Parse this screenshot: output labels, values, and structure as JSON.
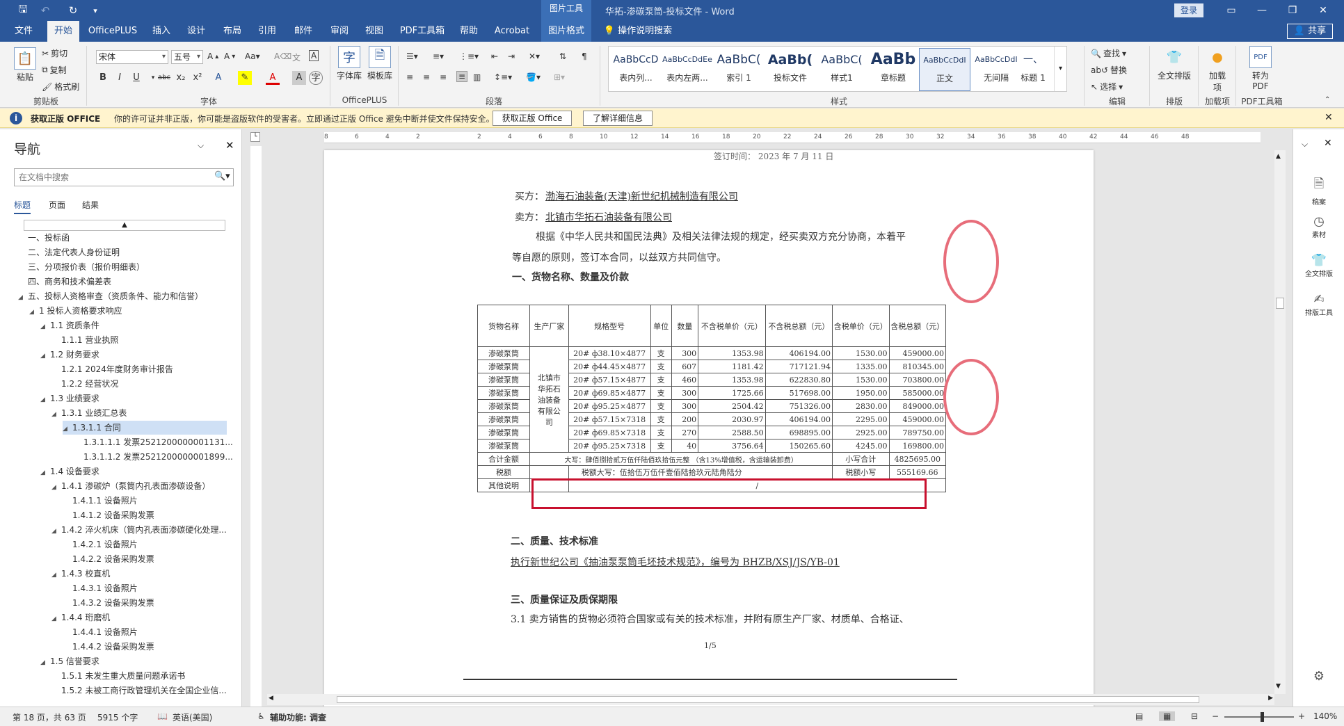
{
  "titlebar": {
    "contextual_tab": "图片工具",
    "title": "华拓-渗碳泵筒-投标文件 - Word",
    "login": "登录"
  },
  "tabs": [
    "文件",
    "开始",
    "OfficePLUS",
    "插入",
    "设计",
    "布局",
    "引用",
    "邮件",
    "审阅",
    "视图",
    "PDF工具箱",
    "帮助",
    "Acrobat",
    "图片格式",
    "操作说明搜索"
  ],
  "share": "共享",
  "ribbon": {
    "clipboard": {
      "paste": "粘贴",
      "cut": "剪切",
      "copy": "复制",
      "format_painter": "格式刷",
      "label": "剪贴板"
    },
    "font": {
      "name": "宋体",
      "size": "五号",
      "label": "字体"
    },
    "officeplus": {
      "font_lib": "字体库",
      "template_lib": "模板库",
      "label": "OfficePLUS"
    },
    "paragraph": {
      "label": "段落"
    },
    "styles": {
      "label": "样式",
      "items": [
        {
          "preview": "AaBbCcD",
          "name": "表内列..."
        },
        {
          "preview": "AaBbCcDdEe",
          "name": "表内左两..."
        },
        {
          "preview": "AaBbC(",
          "name": "索引 1"
        },
        {
          "preview": "AaBb(",
          "name": "投标文件"
        },
        {
          "preview": "AaBbC(",
          "name": "样式1"
        },
        {
          "preview": "AaBb",
          "name": "章标题"
        },
        {
          "preview": "AaBbCcDdI",
          "name": "正文"
        },
        {
          "preview": "AaBbCcDdI",
          "name": "无间隔"
        },
        {
          "preview": "一、",
          "name": "标题 1"
        }
      ]
    },
    "editing": {
      "find": "查找",
      "replace": "替换",
      "select": "选择",
      "label": "编辑"
    },
    "layout": {
      "full_text": "全文排版",
      "label": "排版"
    },
    "addins": {
      "add": "加载项",
      "label": "加载项"
    },
    "pdf": {
      "convert": "转为 PDF",
      "label": "PDF工具箱"
    }
  },
  "infobar": {
    "title": "获取正版 OFFICE",
    "message": "你的许可证并非正版，你可能是盗版软件的受害者。立即通过正版 Office 避免中断并使文件保持安全。",
    "btn_get": "获取正版 Office",
    "btn_learn": "了解详细信息"
  },
  "nav": {
    "title": "导航",
    "search_placeholder": "在文档中搜索",
    "tabs": [
      "标题",
      "页面",
      "结果"
    ],
    "items": [
      {
        "text": "一、投标函",
        "level": 0,
        "exp": ""
      },
      {
        "text": "二、法定代表人身份证明",
        "level": 0,
        "exp": ""
      },
      {
        "text": "三、分项报价表（报价明细表）",
        "level": 0,
        "exp": ""
      },
      {
        "text": "四、商务和技术偏差表",
        "level": 0,
        "exp": ""
      },
      {
        "text": "五、投标人资格审查（资质条件、能力和信誉）",
        "level": 0,
        "exp": "◢"
      },
      {
        "text": "1 投标人资格要求响应",
        "level": 1,
        "exp": "◢"
      },
      {
        "text": "1.1 资质条件",
        "level": 2,
        "exp": "◢"
      },
      {
        "text": "1.1.1 营业执照",
        "level": 3,
        "exp": ""
      },
      {
        "text": "1.2 财务要求",
        "level": 2,
        "exp": "◢"
      },
      {
        "text": "1.2.1 2024年度财务审计报告",
        "level": 3,
        "exp": ""
      },
      {
        "text": "1.2.2 经营状况",
        "level": 3,
        "exp": ""
      },
      {
        "text": "1.3 业绩要求",
        "level": 2,
        "exp": "◢"
      },
      {
        "text": "1.3.1 业绩汇总表",
        "level": 3,
        "exp": "◢"
      },
      {
        "text": "1.3.1.1 合同",
        "level": 4,
        "exp": "◢",
        "sel": true
      },
      {
        "text": "1.3.1.1.1 发票2521200000001131...",
        "level": 5,
        "exp": ""
      },
      {
        "text": "1.3.1.1.2 发票2521200000001899...",
        "level": 5,
        "exp": ""
      },
      {
        "text": "1.4 设备要求",
        "level": 2,
        "exp": "◢"
      },
      {
        "text": "1.4.1 渗碳炉（泵筒内孔表面渗碳设备）",
        "level": 3,
        "exp": "◢"
      },
      {
        "text": "1.4.1.1 设备照片",
        "level": 4,
        "exp": ""
      },
      {
        "text": "1.4.1.2 设备采购发票",
        "level": 4,
        "exp": ""
      },
      {
        "text": "1.4.2 淬火机床（筒内孔表面渗碳硬化处理...",
        "level": 3,
        "exp": "◢"
      },
      {
        "text": "1.4.2.1 设备照片",
        "level": 4,
        "exp": ""
      },
      {
        "text": "1.4.2.2 设备采购发票",
        "level": 4,
        "exp": ""
      },
      {
        "text": "1.4.3 校直机",
        "level": 3,
        "exp": "◢"
      },
      {
        "text": "1.4.3.1 设备照片",
        "level": 4,
        "exp": ""
      },
      {
        "text": "1.4.3.2 设备采购发票",
        "level": 4,
        "exp": ""
      },
      {
        "text": "1.4.4 珩磨机",
        "level": 3,
        "exp": "◢"
      },
      {
        "text": "1.4.4.1 设备照片",
        "level": 4,
        "exp": ""
      },
      {
        "text": "1.4.4.2 设备采购发票",
        "level": 4,
        "exp": ""
      },
      {
        "text": "1.5 信誉要求",
        "level": 2,
        "exp": "◢"
      },
      {
        "text": "1.5.1 未发生重大质量问题承诺书",
        "level": 3,
        "exp": ""
      },
      {
        "text": "1.5.2 未被工商行政管理机关在全国企业信...",
        "level": 3,
        "exp": ""
      }
    ]
  },
  "document": {
    "sign_time": "签订时间：   2023 年  7 月 11 日",
    "buyer_label": "买方：",
    "buyer": "渤海石油装备(天津)新世纪机械制造有限公司",
    "seller_label": "卖方：",
    "seller": "北镇市华拓石油装备有限公司",
    "para1a": "根据《中华人民共和国民法典》及相关法律法规的规定，经买卖双方充分协商，本着平",
    "para1b": "等自愿的原则，签订本合同，以兹双方共同信守。",
    "section1": "一、货物名称、数量及价款",
    "table_headers": [
      "货物名称",
      "生产厂家",
      "规格型号",
      "单位",
      "数量",
      "不含税单价（元）",
      "不含税总额（元）",
      "含税单价（元）",
      "含税总额（元）"
    ],
    "manufacturer": "北镇市华拓石油装备有限公司",
    "rows": [
      [
        "渗碳泵筒",
        "20# ф38.10×4877",
        "支",
        "300",
        "1353.98",
        "406194.00",
        "1530.00",
        "459000.00"
      ],
      [
        "渗碳泵筒",
        "20# ф44.45×4877",
        "支",
        "607",
        "1181.42",
        "717121.94",
        "1335.00",
        "810345.00"
      ],
      [
        "渗碳泵筒",
        "20# ф57.15×4877",
        "支",
        "460",
        "1353.98",
        "622830.80",
        "1530.00",
        "703800.00"
      ],
      [
        "渗碳泵筒",
        "20# ф69.85×4877",
        "支",
        "300",
        "1725.66",
        "517698.00",
        "1950.00",
        "585000.00"
      ],
      [
        "渗碳泵筒",
        "20# ф95.25×4877",
        "支",
        "300",
        "2504.42",
        "751326.00",
        "2830.00",
        "849000.00"
      ],
      [
        "渗碳泵筒",
        "20# ф57.15×7318",
        "支",
        "200",
        "2030.97",
        "406194.00",
        "2295.00",
        "459000.00"
      ],
      [
        "渗碳泵筒",
        "20# ф69.85×7318",
        "支",
        "270",
        "2588.50",
        "698895.00",
        "2925.00",
        "789750.00"
      ],
      [
        "渗碳泵筒",
        "20# ф95.25×7318",
        "支",
        "40",
        "3756.64",
        "150265.60",
        "4245.00",
        "169800.00"
      ]
    ],
    "total_label": "合计金额",
    "total_words": "大写：肆佰捌拾贰万伍仟陆佰玖拾伍元整 （含13%增值税，含运输装卸费）",
    "total_small_label": "小写合计",
    "total_small": "4825695.00",
    "tax_label": "税额",
    "tax_words": "税额大写：伍拾伍万伍仟壹佰陆拾玖元陆角陆分",
    "tax_small_label": "税额小写",
    "tax_small": "555169.66",
    "other_label": "其他说明",
    "other_value": "/",
    "section2": "二、质量、技术标准",
    "section2_text": "执行新世纪公司《抽油泵泵筒毛坯技术规范》，编号为 BHZB/XSJ/JS/YB-01",
    "section3": "三、质量保证及质保期限",
    "section3_text": "3.1 卖方销售的货物必须符合国家或有关的技术标准，并附有原生产厂家、材质单、合格证、",
    "page_no": "1/5"
  },
  "ruler_marks": [
    "8",
    "6",
    "4",
    "2",
    "",
    "2",
    "4",
    "6",
    "8",
    "10",
    "12",
    "14",
    "16",
    "18",
    "20",
    "22",
    "24",
    "26",
    "28",
    "30",
    "32",
    "34",
    "36",
    "38",
    "40",
    "42",
    "44",
    "46",
    "48"
  ],
  "rightpane": [
    "稿案",
    "素材",
    "全文排版",
    "排版工具"
  ],
  "status": {
    "page": "第 18 页，共 63 页",
    "words": "5915 个字",
    "lang": "英语(美国)",
    "access": "辅助功能: 调查",
    "zoom": "140%"
  }
}
